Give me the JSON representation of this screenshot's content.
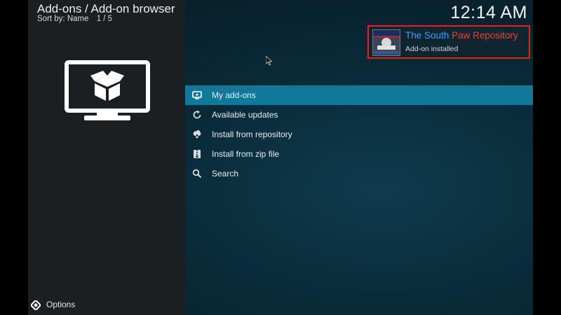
{
  "header": {
    "title": "Add-ons / Add-on browser",
    "sort": "Sort by: Name",
    "page": "1 / 5"
  },
  "clock": "12:14 AM",
  "notification": {
    "title_part1": "The South",
    "title_part2": "Paw Repository",
    "subtitle": "Add-on installed",
    "border_color": "#e5231b"
  },
  "menu": {
    "items": [
      {
        "label": "My add-ons",
        "icon": "monitor-icon",
        "selected": true
      },
      {
        "label": "Available updates",
        "icon": "refresh-icon",
        "selected": false
      },
      {
        "label": "Install from repository",
        "icon": "cloud-download-icon",
        "selected": false
      },
      {
        "label": "Install from zip file",
        "icon": "zip-file-icon",
        "selected": false
      },
      {
        "label": "Search",
        "icon": "search-icon",
        "selected": false
      }
    ]
  },
  "footer": {
    "options_label": "Options"
  },
  "colors": {
    "selected_item": "#12789a",
    "accent_blue": "#3ea0ff",
    "accent_red": "#e0453a"
  }
}
